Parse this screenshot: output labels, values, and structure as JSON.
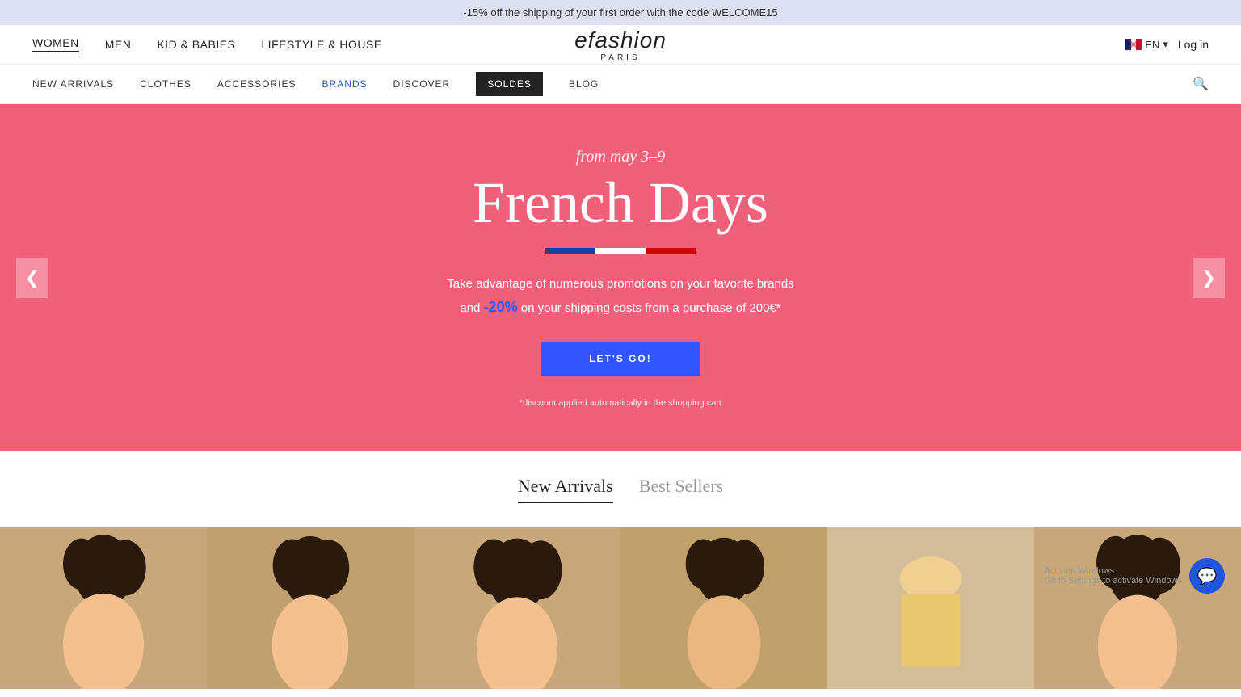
{
  "top_banner": {
    "text": "-15% off the shipping of your first order with the code WELCOME15"
  },
  "header": {
    "nav_left": [
      {
        "label": "WOMEN",
        "active": true
      },
      {
        "label": "MEN",
        "active": false
      },
      {
        "label": "KID & BABIES",
        "active": false
      },
      {
        "label": "LIFESTYLE & HOUSE",
        "active": false
      }
    ],
    "logo": {
      "main": "efashion",
      "sub": "PARIS"
    },
    "lang": {
      "code": "EN",
      "chevron": "▾"
    },
    "login": "Log in"
  },
  "secondary_nav": {
    "items": [
      {
        "label": "NEW ARRIVALS",
        "class": ""
      },
      {
        "label": "CLOTHES",
        "class": ""
      },
      {
        "label": "ACCESSORIES",
        "class": ""
      },
      {
        "label": "BRANDS",
        "class": "brands"
      },
      {
        "label": "DISCOVER",
        "class": ""
      },
      {
        "label": "SOLDES",
        "class": "soldes"
      },
      {
        "label": "BLOG",
        "class": ""
      }
    ],
    "search_icon": "🔍"
  },
  "hero": {
    "subtitle": "from may 3–9",
    "title": "French Days",
    "description_line1": "Take advantage of numerous promotions on your favorite brands",
    "description_line2": "and -20% on your shipping costs from a purchase of 200€*",
    "highlight_text": "-20%",
    "cta_label": "LET'S GO!",
    "disclaimer": "*discount applied automatically in the shopping cart",
    "arrow_left": "❮",
    "arrow_right": "❯",
    "bg_color": "#f0607a"
  },
  "tabs": {
    "items": [
      {
        "label": "New Arrivals",
        "active": true
      },
      {
        "label": "Best Sellers",
        "active": false
      }
    ]
  },
  "products": [
    {
      "bg": "#c8a87a"
    },
    {
      "bg": "#c8a87a"
    },
    {
      "bg": "#c8a87a"
    },
    {
      "bg": "#c8a87a"
    },
    {
      "bg": "#d4be9a"
    },
    {
      "bg": "#c8a87a"
    }
  ],
  "windows_watermark": "Activate Windows\nGo to Settings to activate Windows.",
  "chat_icon": "💬"
}
